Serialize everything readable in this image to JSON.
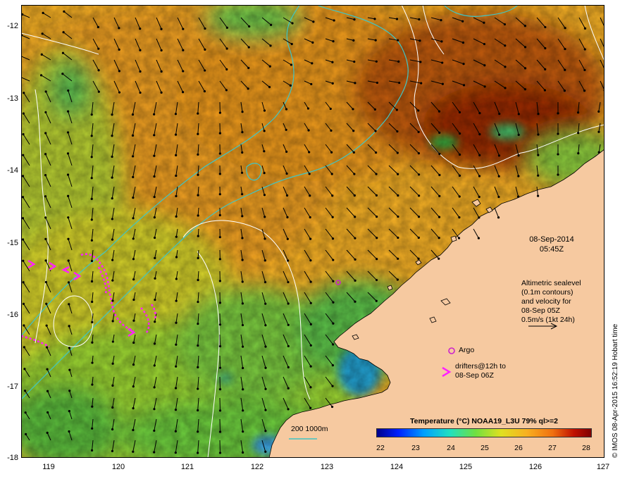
{
  "map": {
    "lat_ticks": [
      "-12",
      "-13",
      "-14",
      "-15",
      "-16",
      "-17",
      "-18"
    ],
    "lon_ticks": [
      "119",
      "120",
      "121",
      "122",
      "123",
      "124",
      "125",
      "126",
      "127"
    ],
    "lat_range": [
      -18,
      -11.85
    ],
    "lon_range": [
      118.62,
      127.0
    ]
  },
  "annotations": {
    "date": "08-Sep-2014",
    "time": "05:45Z",
    "altimetry_lines": [
      "Altimetric sealevel",
      "(0.1m contours)",
      "and velocity for",
      "08-Sep 05Z",
      "0.5m/s (1kt 24h)"
    ],
    "argo_label": "Argo",
    "drifters_lines": [
      "drifters@12h to",
      "08-Sep 06Z"
    ],
    "isobath_label": "200  1000m"
  },
  "colorbar": {
    "title": "Temperature (°C) NOAA19_L3U 79% ql>=2",
    "labels": [
      "22",
      "23",
      "24",
      "25",
      "26",
      "27",
      "28"
    ],
    "min": 22,
    "max": 28
  },
  "credit": "© IMOS 08-Apr-2015 16:52:19 Hobart time",
  "colors": {
    "land": "#f6c9a0",
    "isobath": "#3fc6c6",
    "contour": "#ffffff",
    "arrow": "#000000",
    "drifter": "#ff22ff",
    "argo": "#cc22cc"
  }
}
